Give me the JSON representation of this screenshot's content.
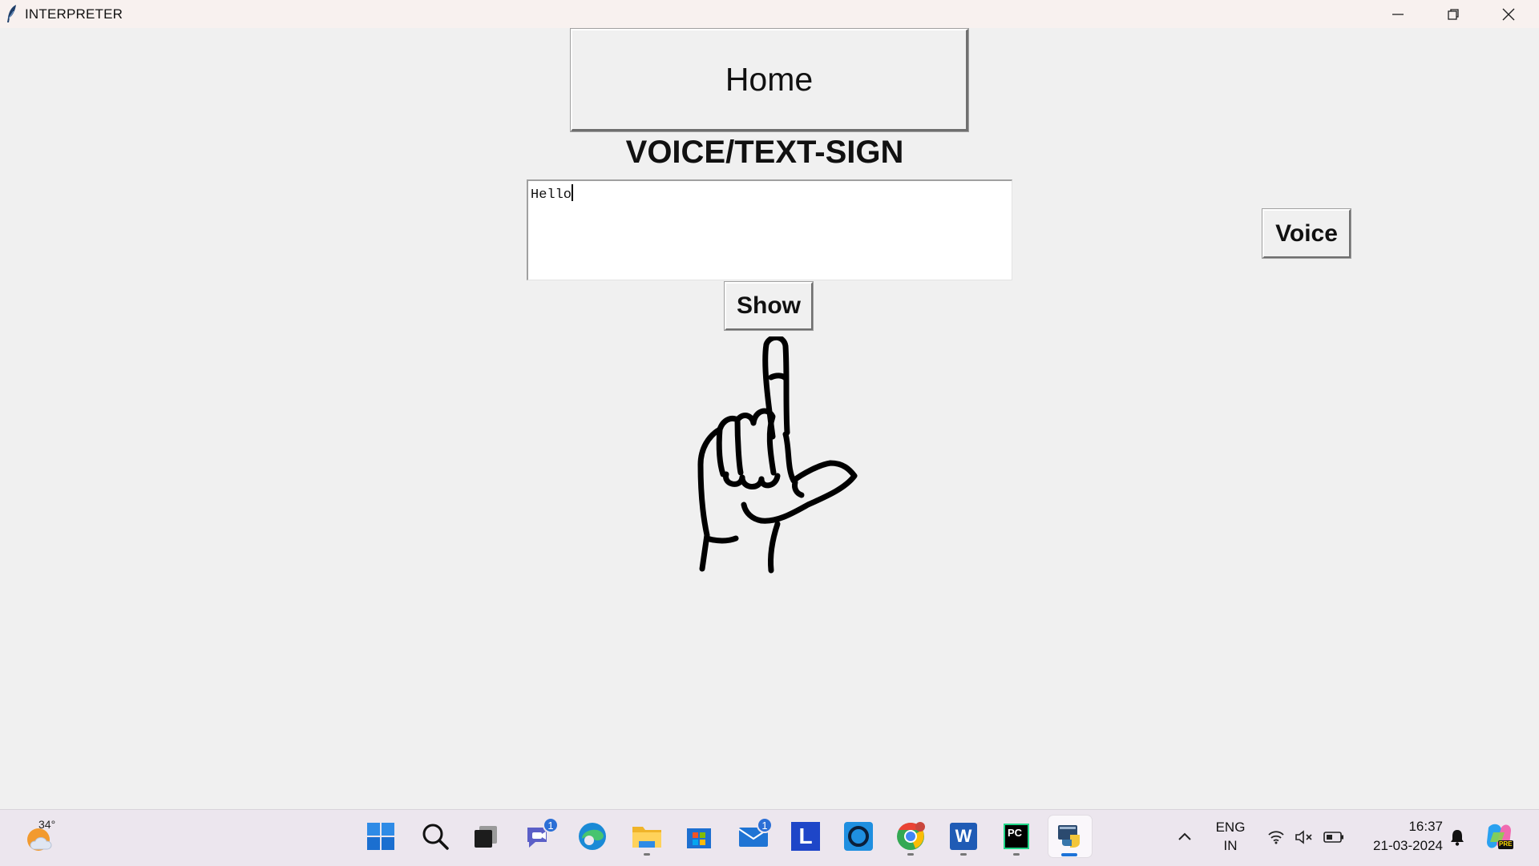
{
  "window": {
    "title": "INTERPRETER"
  },
  "app": {
    "home_label": "Home",
    "heading": "VOICE/TEXT-SIGN",
    "input_value": "Hello",
    "show_label": "Show",
    "voice_label": "Voice"
  },
  "taskbar": {
    "weather_temp": "34°",
    "teams_badge": "1",
    "mail_badge": "1",
    "app_l_label": "L",
    "word_label": "W",
    "pycharm_label": "PC",
    "language_line1": "ENG",
    "language_line2": "IN",
    "time": "16:37",
    "date": "21-03-2024",
    "copilot_tag": "PRE"
  },
  "icons": {
    "app": "feather-icon",
    "minimize": "minimize-icon",
    "restore": "restore-icon",
    "close": "close-icon",
    "sign": "hand-sign-letter-l-icon"
  },
  "colors": {
    "window_bg": "#f0f0f0",
    "titlebar_bg": "#f8f1ef",
    "taskbar_bg": "#ece6ee",
    "accent": "#1d73d8"
  }
}
